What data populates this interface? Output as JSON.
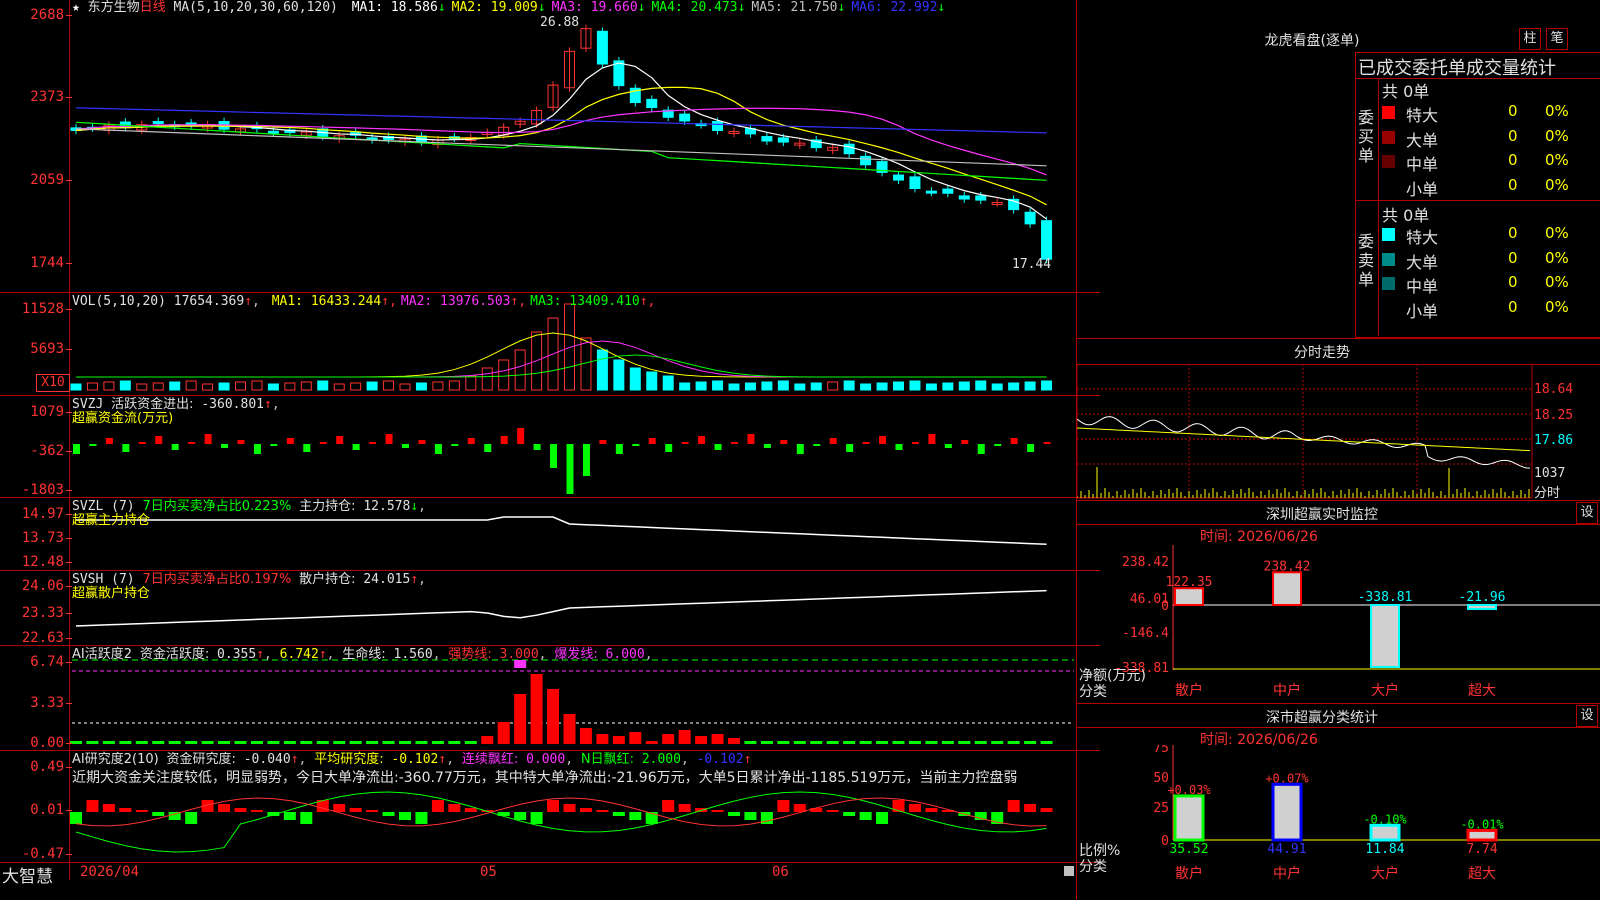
{
  "app_name": "大智慧",
  "stock": {
    "name": "东方生物",
    "period": "日线"
  },
  "main_panel": {
    "ma_header": "MA(5,10,20,30,60,120)",
    "ma": [
      {
        "label": "MA1:",
        "value": "18.586",
        "arrow": "↓",
        "color": "#ffffff"
      },
      {
        "label": "MA2:",
        "value": "19.009",
        "arrow": "↓",
        "color": "#ffff00"
      },
      {
        "label": "MA3:",
        "value": "19.660",
        "arrow": "↓",
        "color": "#ff33ff"
      },
      {
        "label": "MA4:",
        "value": "20.473",
        "arrow": "↓",
        "color": "#00ff00"
      },
      {
        "label": "MA5:",
        "value": "21.750",
        "arrow": "↓",
        "color": "#c0c0c0"
      },
      {
        "label": "MA6:",
        "value": "22.992",
        "arrow": "↓",
        "color": "#3333ff"
      }
    ],
    "y_ticks": [
      "2688",
      "2373",
      "2059",
      "1744"
    ],
    "high_label": "26.88",
    "low_label": "17.44"
  },
  "vol_panel": {
    "header": "VOL(5,10,20)",
    "value": "17654.369",
    "ma": [
      {
        "label": "MA1:",
        "value": "16433.244",
        "arrow": "↑",
        "color": "#ffff00"
      },
      {
        "label": "MA2:",
        "value": "13976.503",
        "arrow": "↑",
        "color": "#ff33ff"
      },
      {
        "label": "MA3:",
        "value": "13409.410",
        "arrow": "↑",
        "color": "#00ff00"
      }
    ],
    "y_ticks": [
      "11528",
      "5693"
    ],
    "unit": "X10"
  },
  "svzj_panel": {
    "name": "SVZJ",
    "label": "活跃资金进出:",
    "value": "-360.801",
    "arrow": "↑",
    "subtitle": "超赢资金流(万元)",
    "y_ticks": [
      "1079",
      "-362",
      "-1803"
    ]
  },
  "svzl_panel": {
    "name": "SVZL (7)",
    "info": "7日内买卖净占比0.223%",
    "label": "主力持仓:",
    "value": "12.578",
    "arrow": "↓",
    "subtitle": "超赢主力持仓",
    "y_ticks": [
      "14.97",
      "13.73",
      "12.48"
    ]
  },
  "svsh_panel": {
    "name": "SVSH (7)",
    "info": "7日内买卖净占比0.197%",
    "label": "散户持仓:",
    "value": "24.015",
    "arrow": "↑",
    "subtitle": "超赢散户持仓",
    "y_ticks": [
      "24.06",
      "23.33",
      "22.63"
    ]
  },
  "ai_active_panel": {
    "name": "AI活跃度2",
    "label": "资金活跃度:",
    "value": "0.355",
    "value2": "6.742",
    "life_label": "生命线:",
    "life_value": "1.560",
    "strong_label": "强势线:",
    "strong_value": "3.000",
    "burst_label": "爆发线:",
    "burst_value": "6.000",
    "y_ticks": [
      "6.74",
      "3.33",
      "0.00"
    ]
  },
  "ai_research_panel": {
    "name": "AI研究度2(10)",
    "label": "资金研究度:",
    "value": "-0.040",
    "avg_label": "平均研究度:",
    "avg_value": "-0.102",
    "red_label": "连续飘红:",
    "red_value": "0.000",
    "nred_label": "N日飘红:",
    "nred_value": "2.000",
    "last_value": "-0.102",
    "comment": "近期大资金关注度较低，明显弱势，今日大单净流出:-360.77万元，其中特大单净流出:-21.96万元，大单5日累计净出-1185.519万元，当前主力控盘弱",
    "y_ticks": [
      "0.49",
      "0.01",
      "-0.47"
    ]
  },
  "x_axis": {
    "labels": [
      "2026/04",
      "05",
      "06"
    ]
  },
  "right_panel": {
    "dragon_title": "龙虎看盘(逐单)",
    "btn_zhu": "柱",
    "btn_bi": "笔",
    "stat_title": "已成交委托单成交量统计",
    "buy_side": {
      "side_label": "委买单",
      "total": "共 0单",
      "rows": [
        {
          "name": "特大",
          "vol": "0",
          "pct": "0%",
          "color": "#ff0000"
        },
        {
          "name": "大单",
          "vol": "0",
          "pct": "0%",
          "color": "#990000"
        },
        {
          "name": "中单",
          "vol": "0",
          "pct": "0%",
          "color": "#660000"
        },
        {
          "name": "小单",
          "vol": "0",
          "pct": "0%",
          "color": ""
        }
      ]
    },
    "sell_side": {
      "side_label": "委卖单",
      "total": "共 0单",
      "rows": [
        {
          "name": "特大",
          "vol": "0",
          "pct": "0%",
          "color": "#00ffff"
        },
        {
          "name": "大单",
          "vol": "0",
          "pct": "0%",
          "color": "#008b8b"
        },
        {
          "name": "中单",
          "vol": "0",
          "pct": "0%",
          "color": "#006b6b"
        },
        {
          "name": "小单",
          "vol": "0",
          "pct": "0%",
          "color": ""
        }
      ]
    },
    "intraday_title": "分时走势",
    "intraday_ticks": [
      "18.64",
      "18.25",
      "17.86",
      "1037",
      "分时"
    ],
    "monitor": {
      "title": "深圳超赢实时监控",
      "btn": "设",
      "time": "时间: 2026/06/26",
      "y_ticks": [
        "238.42",
        "46.01",
        "0",
        "-146.4",
        "-338.81"
      ],
      "y_label": "净额(万元)",
      "x_label": "分类",
      "categories": [
        "散户",
        "中户",
        "大户",
        "超大"
      ],
      "values": [
        "122.35",
        "238.42",
        "-338.81",
        "-21.96"
      ]
    },
    "classify": {
      "title": "深市超赢分类统计",
      "btn": "设",
      "time": "时间: 2026/06/26",
      "y_ticks": [
        "75",
        "50",
        "25",
        "0"
      ],
      "y_label": "比例%",
      "x_label": "分类",
      "categories": [
        "散户",
        "中户",
        "大户",
        "超大"
      ],
      "changes": [
        "+0.03%",
        "+0.07%",
        "-0.10%",
        "-0.01%"
      ],
      "values": [
        "35.52",
        "44.91",
        "11.84",
        "7.74"
      ]
    }
  }
}
